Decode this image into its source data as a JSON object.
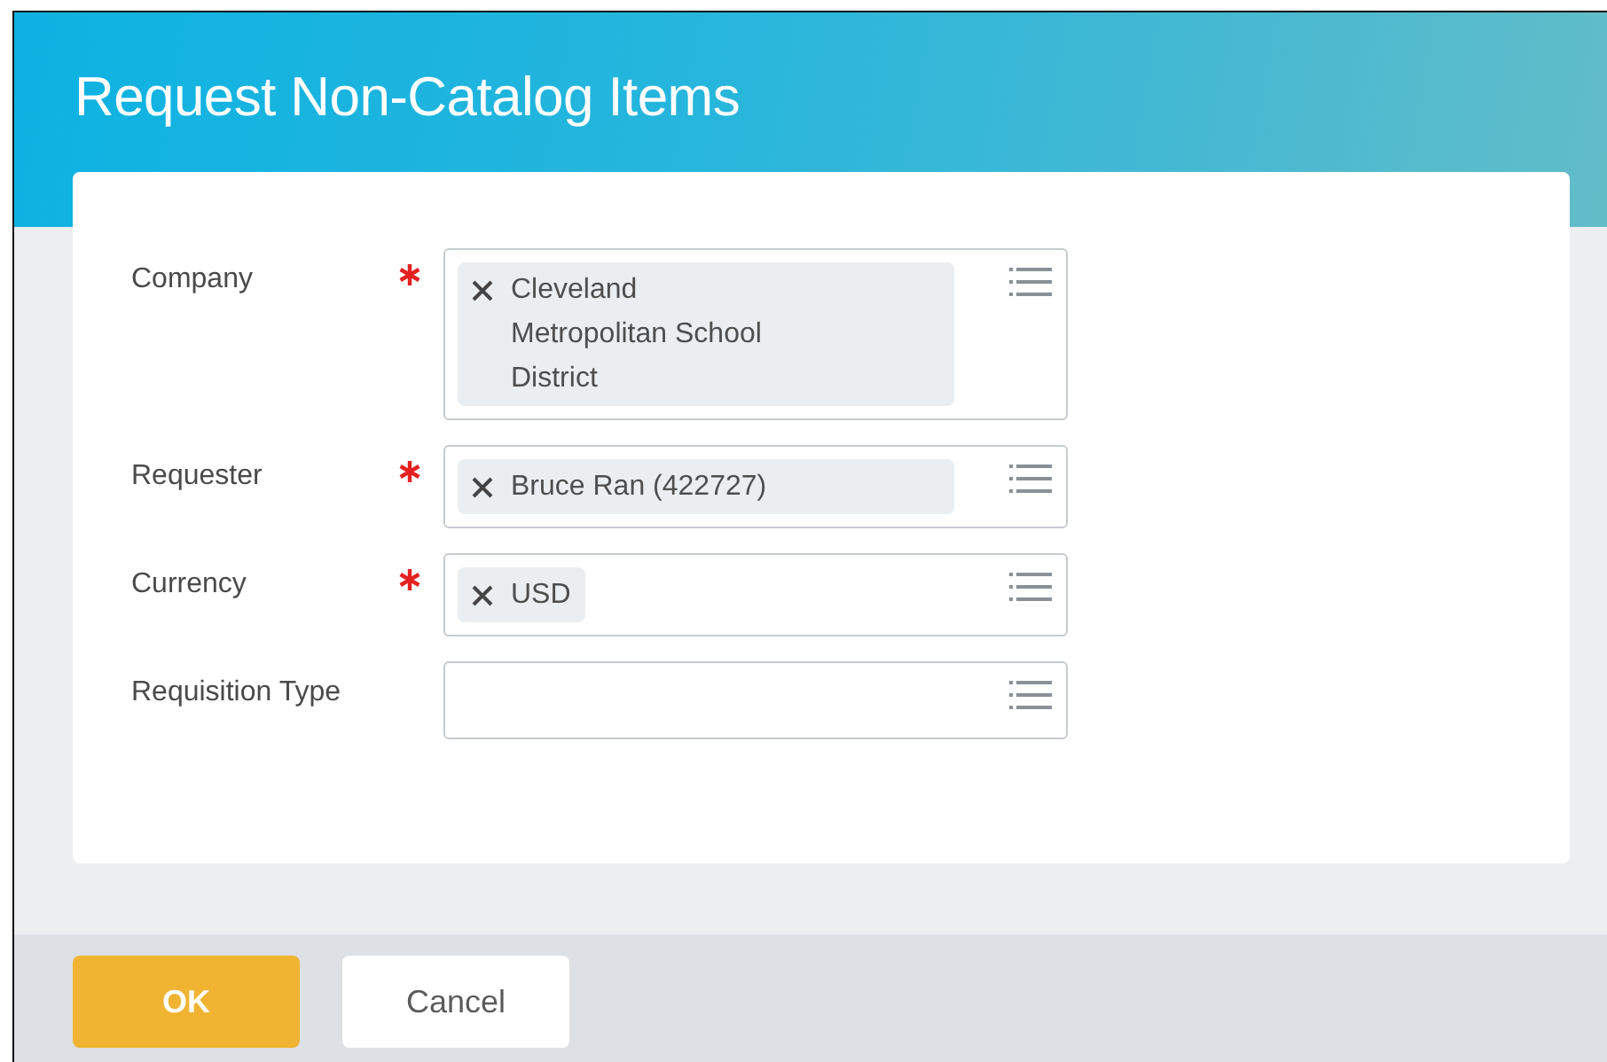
{
  "dialog": {
    "title": "Request Non-Catalog Items"
  },
  "fields": [
    {
      "label": "Company",
      "required": true,
      "values": [
        "Cleveland Metropolitan School District"
      ]
    },
    {
      "label": "Requester",
      "required": true,
      "values": [
        "Bruce Ran (422727)"
      ]
    },
    {
      "label": "Currency",
      "required": true,
      "values": [
        "USD"
      ]
    },
    {
      "label": "Requisition Type",
      "required": false
    }
  ],
  "buttons": [
    {
      "label": "OK",
      "kind": "primary"
    },
    {
      "label": "Cancel",
      "kind": "secondary"
    }
  ]
}
